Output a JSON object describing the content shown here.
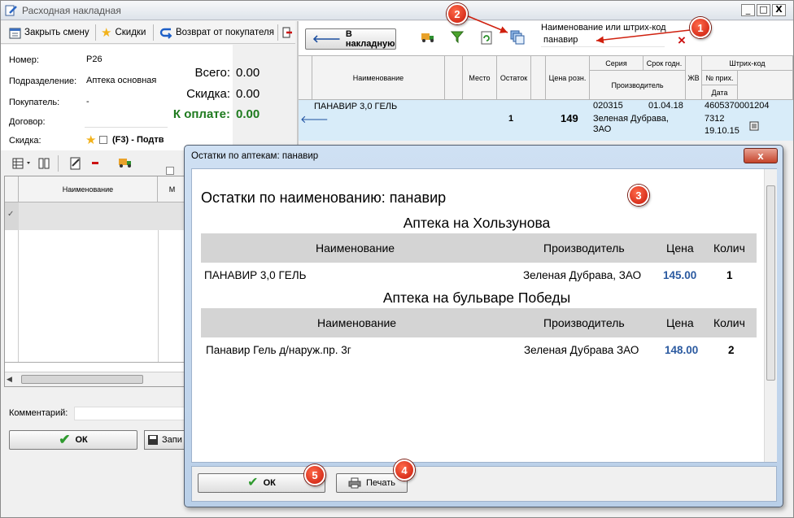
{
  "window": {
    "title": "Расходная накладная",
    "controls": [
      "_",
      "□",
      "X"
    ]
  },
  "left_toolbar": {
    "close_shift": "Закрыть смену",
    "discounts": "Скидки",
    "return_from_buyer": "Возврат от покупателя"
  },
  "form": {
    "number_label": "Номер:",
    "number_value": "Р26",
    "department_label": "Подразделение:",
    "department_value": "Аптека основная",
    "buyer_label": "Покупатель:",
    "buyer_value": "-",
    "contract_label": "Договор:",
    "contract_value": "",
    "discount_label": "Скидка:",
    "discount_value": "(F3) - Подтв",
    "total_label": "Всего:",
    "total_value": "0.00",
    "discount_sum_label": "Скидка:",
    "discount_sum_value": "0.00",
    "to_pay_label": "К оплате:",
    "to_pay_value": "0.00"
  },
  "left_grid": {
    "col_name": "Наименование",
    "col_m": "М",
    "check": "✓"
  },
  "comment": {
    "label": "Комментарий:",
    "value": ""
  },
  "main_buttons": {
    "ok": "ОК",
    "save": "Запи"
  },
  "right_toolbar": {
    "to_invoice": "В накладную",
    "search_label": "Наименование или штрих-код",
    "search_value": "панавир",
    "clear": "×"
  },
  "grid": {
    "headers": {
      "name": "Наименование",
      "place": "Место",
      "stock": "Остаток",
      "price": "Цена розн.",
      "series": "Серия",
      "expiry": "Срок годн.",
      "maker": "Производитель",
      "zhv": "ЖВ",
      "barcode": "Штрих-код",
      "receipt_no": "№ прих.",
      "date": "Дата"
    },
    "row": {
      "name": "ПАНАВИР 3,0 ГЕЛЬ",
      "stock": "1",
      "price": "149",
      "series": "020315",
      "expiry": "01.04.18",
      "maker": "Зеленая Дубрава, ЗАО",
      "barcode": "4605370001204",
      "receipt_no": "7312",
      "date": "19.10.15"
    }
  },
  "dialog": {
    "title": "Остатки по аптекам: панавир",
    "heading": "Остатки по наименованию: панавир",
    "col_name": "Наименование",
    "col_maker": "Производитель",
    "col_price": "Цена",
    "col_qty": "Колич",
    "sections": [
      {
        "pharmacy": "Аптека на Хользунова",
        "name": "ПАНАВИР 3,0 ГЕЛЬ",
        "maker": "Зеленая Дубрава, ЗАО",
        "price": "145.00",
        "qty": "1"
      },
      {
        "pharmacy": "Аптека на бульваре Победы",
        "name": "Панавир Гель д/наруж.пр. 3г",
        "maker": "Зеленая Дубрава ЗАО",
        "price": "148.00",
        "qty": "2"
      }
    ],
    "ok": "ОК",
    "print": "Печать",
    "close": "x"
  },
  "badges": [
    "1",
    "2",
    "3",
    "4",
    "5"
  ],
  "colors": {
    "to_pay": "#1e7a1e",
    "price": "#2b5aa0",
    "badge": "#d0200e",
    "selection": "#d8ecf9"
  }
}
